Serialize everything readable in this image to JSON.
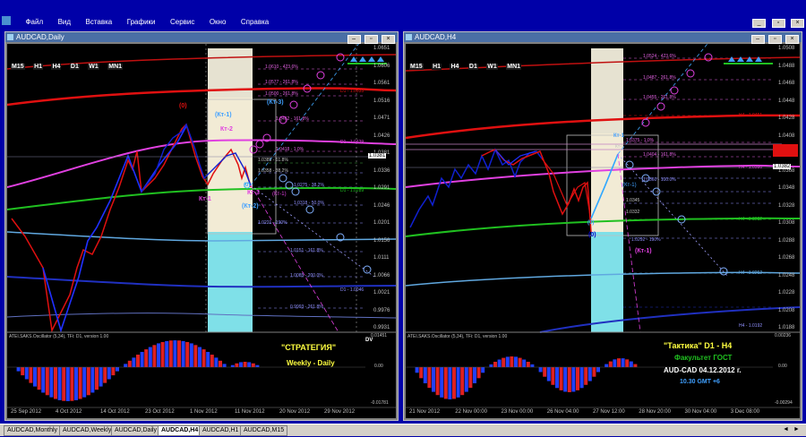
{
  "menu": [
    "Файл",
    "Вид",
    "Вставка",
    "Графики",
    "Сервис",
    "Окно",
    "Справка"
  ],
  "timeframes": [
    "M15",
    "H1",
    "H4",
    "D1",
    "W1",
    "MN1"
  ],
  "left": {
    "title": "AUDCAD,Daily",
    "osc_label": "ATEI.SAKS.Oscillator (5,34), TFi: D1, version 1.00",
    "prices": [
      "1.0651",
      "1.0606",
      "1.0561",
      "1.0516",
      "1.0471",
      "1.0426",
      "1.0381",
      "1.0336",
      "1.0291",
      "1.0246",
      "1.0201",
      "1.0156",
      "1.0111",
      "1.0066",
      "1.0021",
      "0.9976",
      "0.9931"
    ],
    "osc_scale": [
      "0.01451",
      "0.00",
      "-0.01781"
    ],
    "dates": [
      "25 Sep 2012",
      "4 Oct 2012",
      "14 Oct 2012",
      "23 Oct 2012",
      "1 Nov 2012",
      "11 Nov 2012",
      "20 Nov 2012",
      "29 Nov 2012"
    ],
    "current_price": "1.0381",
    "labels": {
      "zero_top": "(0)",
      "kt1_top": "(Кт-1)",
      "kt2": "Кт-2",
      "kt3_top": "(Кт-3)",
      "kt1_bot": "Кт-1",
      "kt3_bot": "Кт-3",
      "kt2_bot": "(Кт-2)",
      "zero_bot": "(0)",
      "ktp1": "(Кт-1)",
      "strategy": "\"СТРАТЕГИЯ\"",
      "weekly": "Weekly - Daily",
      "dv": "DV"
    },
    "level_labels": [
      "1.0610 - 423.6%",
      "1.0577 - 261.8%",
      "1.0500 - 261.8%",
      "1.0462 - 161.8%",
      "1.0418 - 1.0%",
      "1.0385 - 61.8%",
      "1.0358 - 38.2%",
      "1.0318 - 50.0%",
      "1.0275 - 38.2%",
      "1.0221 - 190%",
      "1.0151 - 161.8%",
      "1.0085 - 200.0%",
      "0.9993 - 261.8%",
      "D1 - 1.0533",
      "D1 - 1.0429",
      "D1 - 1.0289",
      "D1 - 1.0046"
    ]
  },
  "right": {
    "title": "AUDCAD,H4",
    "osc_label": "ATEI.SAKS.Oscillator (5,34), TFi: D1, version 1.00",
    "prices": [
      "1.0508",
      "1.0488",
      "1.0468",
      "1.0448",
      "1.0428",
      "1.0408",
      "1.0388",
      "1.0368",
      "1.0348",
      "1.0328",
      "1.0308",
      "1.0288",
      "1.0268",
      "1.0248",
      "1.0228",
      "1.0208",
      "1.0188"
    ],
    "osc_scale": [
      "0.00236",
      "0.00",
      "-0.00294"
    ],
    "dates": [
      "21 Nov 2012",
      "22 Nov 00:00",
      "23 Nov 00:00",
      "26 Nov 04:00",
      "27 Nov 12:00",
      "28 Nov 20:00",
      "30 Nov 04:00",
      "3 Dec 08:00"
    ],
    "current_price": "1.0382",
    "labels": {
      "kt1": "Кт-1",
      "kt_p": "Кт-1",
      "kt1b": "(Кт-1)",
      "kt1c": "(Кт-1)",
      "zero": "(0)",
      "zero2": "(0)",
      "tactic": "\"Тактика\"  D1 - H4",
      "faculty": "Факультет ГОСТ",
      "audcad": "AUD-CAD  04.12.2012  г.",
      "time": "10.30    GMT +6"
    },
    "level_labels": [
      "1.0524 - 423.6%",
      "1.0487 - 261.8%",
      "1.0455 - 261.8%",
      "1.0404 - 161.8%",
      "1.0375 - 1.0%",
      "1.0360 - 100.0%",
      "1.0345",
      "1.0332",
      "1.0292 - 190%",
      "H4 - 1.0451",
      "H4 - 1.0380",
      "H4 - 1.0322",
      "H4 - 1.0252",
      "H4 - 1.0192"
    ]
  },
  "tabs": [
    "AUDCAD,Monthly",
    "AUDCAD,Weekly",
    "AUDCAD,Daily",
    "AUDCAD,H4",
    "AUDCAD,H1",
    "AUDCAD,M15"
  ],
  "active_tab": "AUDCAD,H4",
  "colors": {
    "bg": "#0000a8",
    "plot": "#000000",
    "red": "#e01010",
    "blue": "#1c2fd0",
    "magenta": "#e040e0",
    "green": "#20b020",
    "cyan": "#40c8e0"
  }
}
